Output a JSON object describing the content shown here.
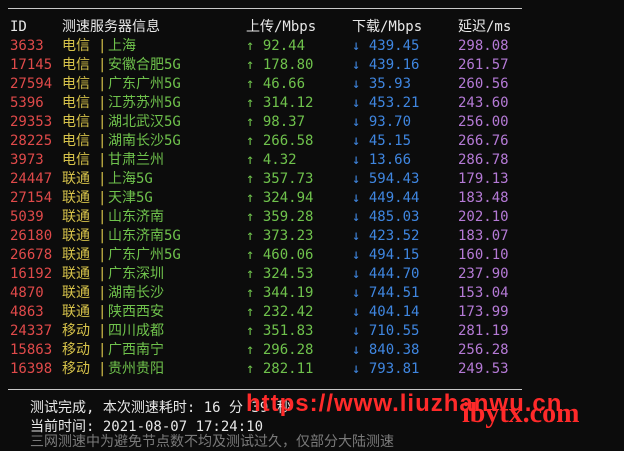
{
  "header": {
    "id": "ID",
    "server": "测速服务器信息",
    "upload": "上传/Mbps",
    "download": "下载/Mbps",
    "latency": "延迟/ms"
  },
  "rows": [
    {
      "id": "3633",
      "isp": "电信",
      "sep": "|",
      "city": "上海",
      "up": "↑ 92.44",
      "down": "↓ 439.45",
      "lat": "298.08"
    },
    {
      "id": "17145",
      "isp": "电信",
      "sep": "|",
      "city": "安徽合肥5G",
      "up": "↑ 178.80",
      "down": "↓ 439.16",
      "lat": "261.57"
    },
    {
      "id": "27594",
      "isp": "电信",
      "sep": "|",
      "city": "广东广州5G",
      "up": "↑ 46.66",
      "down": "↓ 35.93",
      "lat": "260.56"
    },
    {
      "id": "5396",
      "isp": "电信",
      "sep": "|",
      "city": "江苏苏州5G",
      "up": "↑ 314.12",
      "down": "↓ 453.21",
      "lat": "243.60"
    },
    {
      "id": "29353",
      "isp": "电信",
      "sep": "|",
      "city": "湖北武汉5G",
      "up": "↑ 98.37",
      "down": "↓ 93.70",
      "lat": "256.00"
    },
    {
      "id": "28225",
      "isp": "电信",
      "sep": "|",
      "city": "湖南长沙5G",
      "up": "↑ 266.58",
      "down": "↓ 45.15",
      "lat": "266.76"
    },
    {
      "id": "3973",
      "isp": "电信",
      "sep": "|",
      "city": "甘肃兰州",
      "up": "↑ 4.32",
      "down": "↓ 13.66",
      "lat": "286.78"
    },
    {
      "id": "24447",
      "isp": "联通",
      "sep": "|",
      "city": "上海5G",
      "up": "↑ 357.73",
      "down": "↓ 594.43",
      "lat": "179.13"
    },
    {
      "id": "27154",
      "isp": "联通",
      "sep": "|",
      "city": "天津5G",
      "up": "↑ 324.94",
      "down": "↓ 449.44",
      "lat": "183.48"
    },
    {
      "id": "5039",
      "isp": "联通",
      "sep": "|",
      "city": "山东济南",
      "up": "↑ 359.28",
      "down": "↓ 485.03",
      "lat": "202.10"
    },
    {
      "id": "26180",
      "isp": "联通",
      "sep": "|",
      "city": "山东济南5G",
      "up": "↑ 373.23",
      "down": "↓ 423.52",
      "lat": "183.07"
    },
    {
      "id": "26678",
      "isp": "联通",
      "sep": "|",
      "city": "广东广州5G",
      "up": "↑ 460.06",
      "down": "↓ 494.15",
      "lat": "160.10"
    },
    {
      "id": "16192",
      "isp": "联通",
      "sep": "|",
      "city": "广东深圳",
      "up": "↑ 324.53",
      "down": "↓ 444.70",
      "lat": "237.90"
    },
    {
      "id": "4870",
      "isp": "联通",
      "sep": "|",
      "city": "湖南长沙",
      "up": "↑ 344.19",
      "down": "↓ 744.51",
      "lat": "153.04"
    },
    {
      "id": "4863",
      "isp": "联通",
      "sep": "|",
      "city": "陕西西安",
      "up": "↑ 232.42",
      "down": "↓ 404.14",
      "lat": "173.99"
    },
    {
      "id": "24337",
      "isp": "移动",
      "sep": "|",
      "city": "四川成都",
      "up": "↑ 351.83",
      "down": "↓ 710.55",
      "lat": "281.19"
    },
    {
      "id": "15863",
      "isp": "移动",
      "sep": "|",
      "city": "广西南宁",
      "up": "↑ 296.28",
      "down": "↓ 840.38",
      "lat": "256.28"
    },
    {
      "id": "16398",
      "isp": "移动",
      "sep": "|",
      "city": "贵州贵阳",
      "up": "↑ 282.11",
      "down": "↓ 793.81",
      "lat": "249.53"
    }
  ],
  "footer": {
    "done": "测试完成, 本次测速耗时: 16 分 39 秒",
    "time": "当前时间: 2021-08-07 17:24:10",
    "cut": "三网测速中为避免节点数不均及测试过久，仅部分大陆测速"
  },
  "watermark": {
    "left": "https://www.liuzhanwu.cn",
    "right": "ibytx.com"
  },
  "colors": {
    "background": "#0c0c0c",
    "id": "#e04a4a",
    "isp": "#d6c24a",
    "city": "#6fc24c",
    "upload": "#6fc24c",
    "download": "#3f86e0",
    "latency": "#b57ad6",
    "watermark": "#ff2a2a"
  }
}
